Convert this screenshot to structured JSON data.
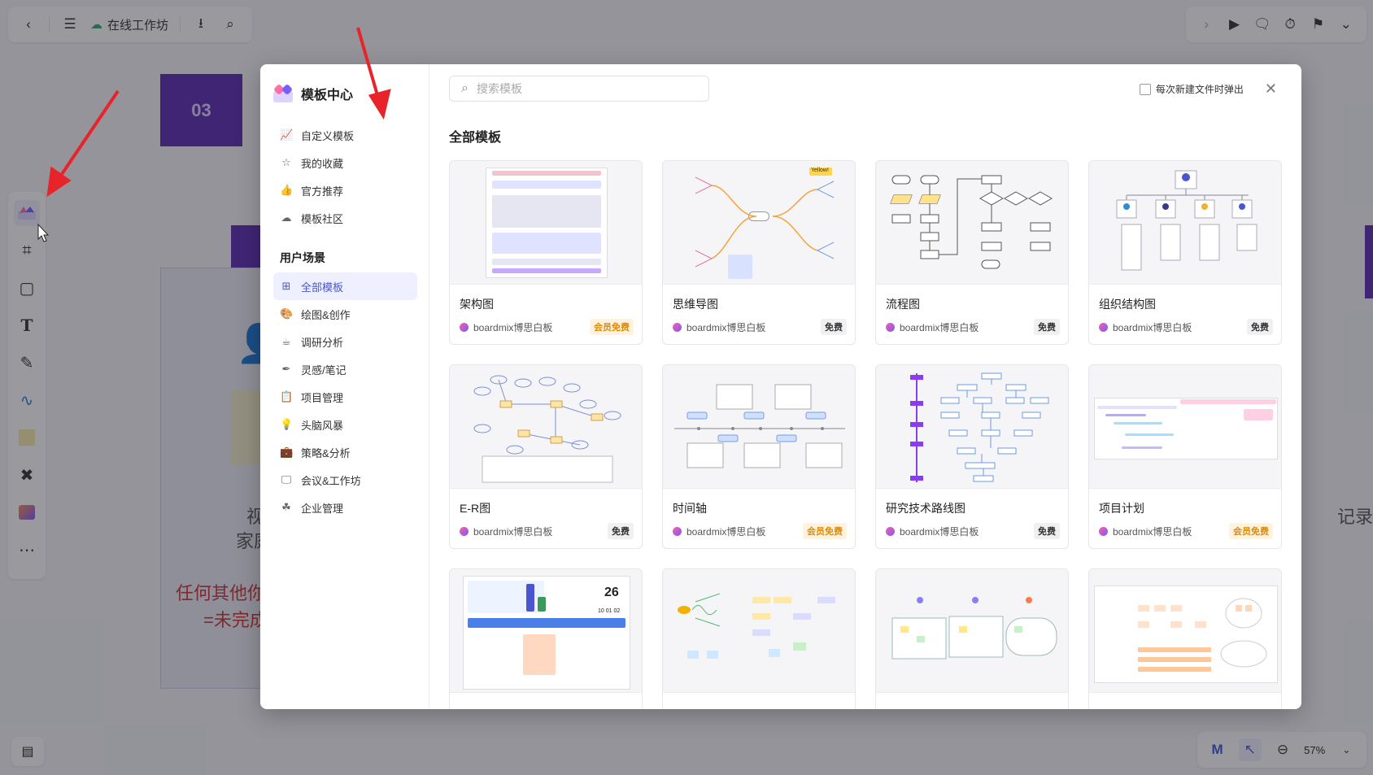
{
  "topbar": {
    "title": "在线工作坊"
  },
  "canvas": {
    "box_label": "03",
    "text1": "视",
    "text2": "家庭",
    "red1": "任何其他你",
    "red2": "=未完成",
    "right_text": "记录"
  },
  "zoom": {
    "level": "57%"
  },
  "modal": {
    "title": "模板中心",
    "nav_top": [
      {
        "label": "自定义模板",
        "icon": "chart-icon"
      },
      {
        "label": "我的收藏",
        "icon": "star-icon"
      },
      {
        "label": "官方推荐",
        "icon": "thumb-icon"
      },
      {
        "label": "模板社区",
        "icon": "community-icon"
      }
    ],
    "section_label": "用户场景",
    "nav_scenes": [
      {
        "label": "全部模板",
        "icon": "grid-icon",
        "active": true
      },
      {
        "label": "绘图&创作",
        "icon": "palette-icon"
      },
      {
        "label": "调研分析",
        "icon": "cup-icon"
      },
      {
        "label": "灵感/笔记",
        "icon": "feather-icon"
      },
      {
        "label": "项目管理",
        "icon": "clipboard-icon"
      },
      {
        "label": "头脑风暴",
        "icon": "bulb-icon"
      },
      {
        "label": "策略&分析",
        "icon": "briefcase-icon"
      },
      {
        "label": "会议&工作坊",
        "icon": "presentation-icon"
      },
      {
        "label": "企业管理",
        "icon": "org-icon"
      }
    ],
    "search_placeholder": "搜索模板",
    "checkbox_label": "每次新建文件时弹出",
    "section_title": "全部模板",
    "templates": [
      {
        "name": "架构图",
        "author": "boardmix博思白板",
        "badge": "会员免费",
        "vip": true
      },
      {
        "name": "思维导图",
        "author": "boardmix博思白板",
        "badge": "免费",
        "vip": false
      },
      {
        "name": "流程图",
        "author": "boardmix博思白板",
        "badge": "免费",
        "vip": false
      },
      {
        "name": "组织结构图",
        "author": "boardmix博思白板",
        "badge": "免费",
        "vip": false
      },
      {
        "name": "E-R图",
        "author": "boardmix博思白板",
        "badge": "免费",
        "vip": false
      },
      {
        "name": "时间轴",
        "author": "boardmix博思白板",
        "badge": "会员免费",
        "vip": true
      },
      {
        "name": "研究技术路线图",
        "author": "boardmix博思白板",
        "badge": "免费",
        "vip": false
      },
      {
        "name": "项目计划",
        "author": "boardmix博思白板",
        "badge": "会员免费",
        "vip": true
      },
      {
        "name": "",
        "author": "",
        "badge": "",
        "vip": false
      },
      {
        "name": "",
        "author": "",
        "badge": "",
        "vip": false
      },
      {
        "name": "",
        "author": "",
        "badge": "",
        "vip": false
      },
      {
        "name": "",
        "author": "",
        "badge": "",
        "vip": false
      }
    ],
    "thumb_text": {
      "calendar_day": "26",
      "calendar_nums": "10  01  02",
      "mindmap_tag": "Yellow!"
    }
  },
  "colors": {
    "accent": "#4a55d0",
    "purple": "#5b2bb5",
    "vip": "#e08a00",
    "arrow": "#e8232a"
  }
}
